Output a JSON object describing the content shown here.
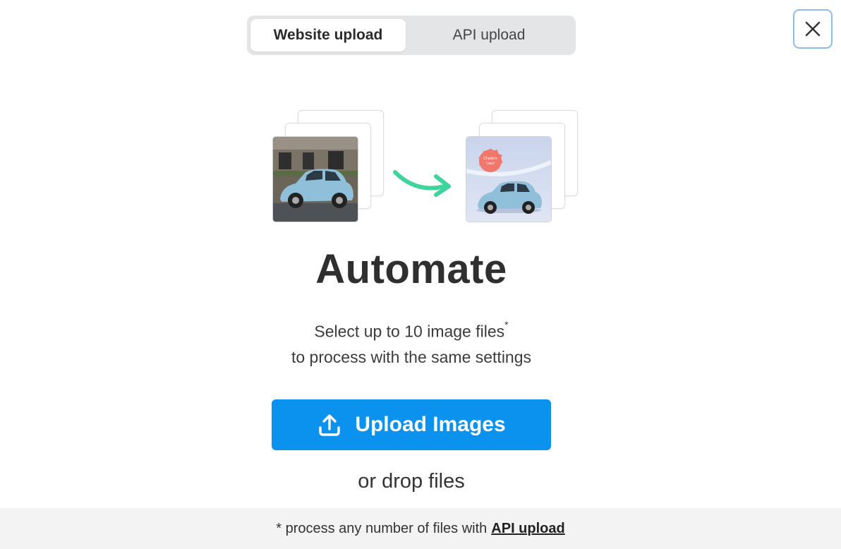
{
  "tabs": [
    {
      "label": "Website upload",
      "active": true
    },
    {
      "label": "API upload",
      "active": false
    }
  ],
  "close": {
    "icon": "close-icon"
  },
  "illustration": {
    "badge_text": "Charlie's Cars!",
    "arrow_color": "#3ed49b"
  },
  "main": {
    "title": "Automate",
    "desc_line1": "Select up to 10 image files",
    "desc_mark": "*",
    "desc_line2": "to process with the same settings",
    "upload_label": "Upload Images",
    "drop_text": "or drop files"
  },
  "footer": {
    "prefix": "* process any number of files with",
    "link": "API upload"
  },
  "colors": {
    "accent": "#0a92ee",
    "arrow": "#3ed49b",
    "badge": "#f2776b"
  }
}
